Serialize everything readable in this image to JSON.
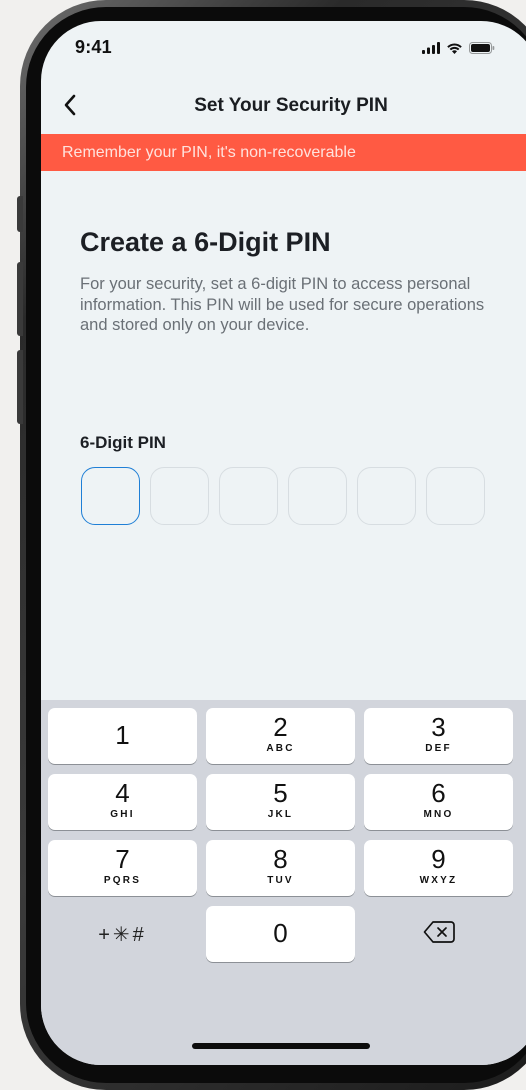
{
  "status_bar": {
    "time": "9:41",
    "icons": [
      "cellular-signal-icon",
      "wifi-icon",
      "battery-icon"
    ]
  },
  "nav": {
    "back_icon": "chevron-left-icon",
    "title": "Set Your Security PIN"
  },
  "banner": {
    "text": "Remember your PIN, it's non-recoverable",
    "background": "#ff5a43"
  },
  "content": {
    "heading": "Create a 6-Digit PIN",
    "description": "For your security, set a 6-digit PIN to access personal information. This PIN will be used for secure operations and stored only on your device.",
    "pin_label": "6-Digit PIN",
    "pin_boxes": 6,
    "active_box_index": 0,
    "active_color": "#1f7fd6"
  },
  "keypad": {
    "keys": [
      {
        "digit": "1",
        "letters": ""
      },
      {
        "digit": "2",
        "letters": "ABC"
      },
      {
        "digit": "3",
        "letters": "DEF"
      },
      {
        "digit": "4",
        "letters": "GHI"
      },
      {
        "digit": "5",
        "letters": "JKL"
      },
      {
        "digit": "6",
        "letters": "MNO"
      },
      {
        "digit": "7",
        "letters": "PQRS"
      },
      {
        "digit": "8",
        "letters": "TUV"
      },
      {
        "digit": "9",
        "letters": "WXYZ"
      }
    ],
    "symbols": "+✳#",
    "zero": "0",
    "delete_icon": "backspace-icon"
  }
}
